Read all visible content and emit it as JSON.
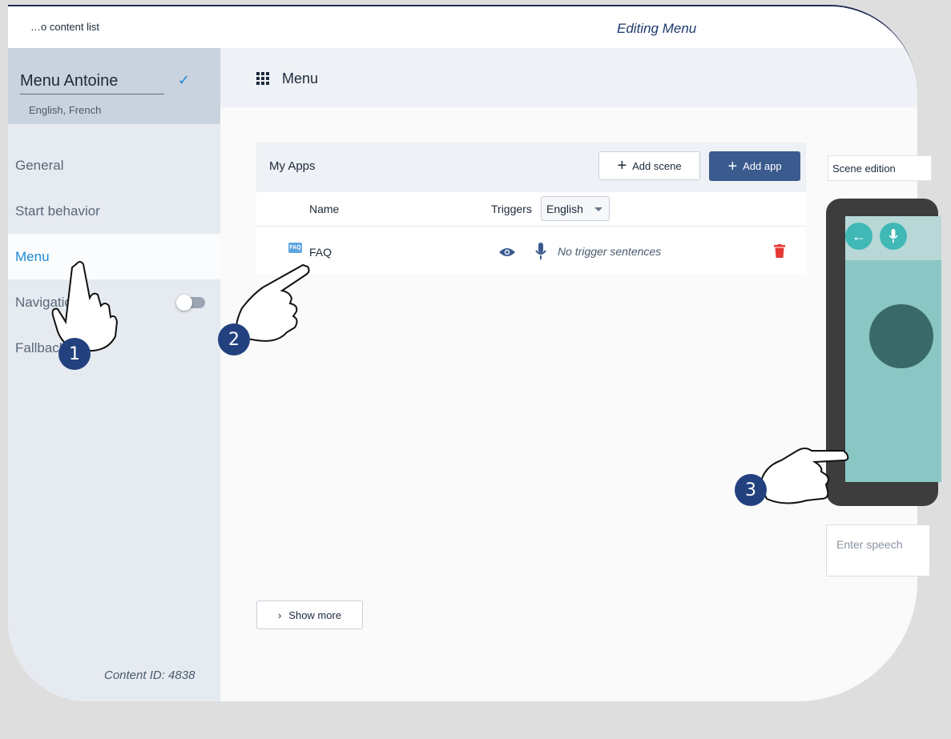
{
  "topbar": {
    "back_link": "…o content list",
    "page_heading": "Editing Menu"
  },
  "sidebar": {
    "content_name": "Menu Antoine",
    "languages": "English, French",
    "items": [
      {
        "label": "General",
        "active": false
      },
      {
        "label": "Start behavior",
        "active": false
      },
      {
        "label": "Menu",
        "active": true
      },
      {
        "label": "Navigation",
        "active": false
      },
      {
        "label": "Fallback",
        "active": false
      }
    ],
    "navigation_toggle": "off",
    "content_id": "Content ID: 4838"
  },
  "main": {
    "title": "Menu"
  },
  "apps": {
    "title": "My Apps",
    "add_scene": "Add scene",
    "add_app": "Add app",
    "col_name": "Name",
    "col_triggers": "Triggers",
    "language": "English",
    "rows": [
      {
        "icon": "FAQ",
        "name": "FAQ",
        "triggers": "No trigger sentences"
      }
    ],
    "show_more": "Show more"
  },
  "scene": {
    "label": "Scene edition",
    "speech_placeholder": "Enter speech"
  },
  "annotations": [
    "1",
    "2",
    "3"
  ],
  "colors": {
    "accent": "#1f8ad6",
    "primary_button": "#3b5a8e",
    "badge": "#23417f",
    "delete": "#e53935"
  }
}
